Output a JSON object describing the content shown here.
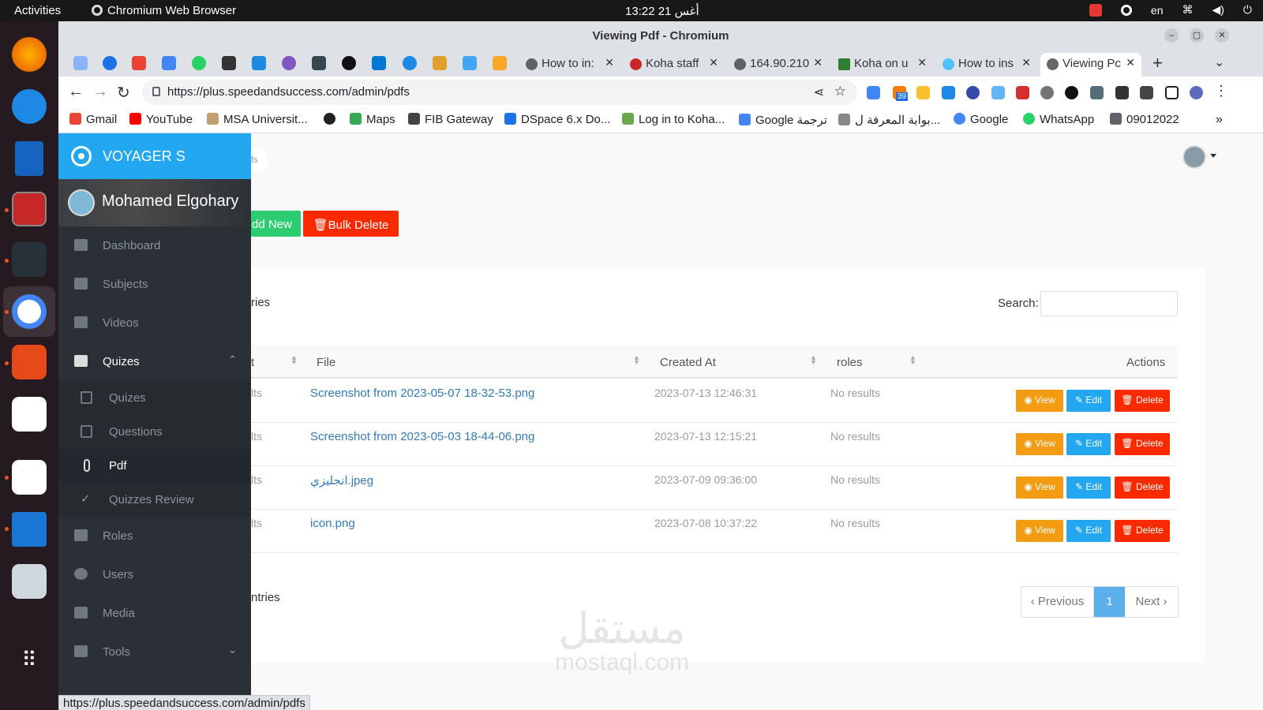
{
  "os": {
    "activities": "Activities",
    "app_name": "Chromium Web Browser",
    "clock": "13:22  21 أغس",
    "lang": "en"
  },
  "window_title": "Viewing Pdf - Chromium",
  "tabs": [
    {
      "label": "How to in:"
    },
    {
      "label": "Koha staff"
    },
    {
      "label": "164.90.210"
    },
    {
      "label": "Koha on u"
    },
    {
      "label": "How to ins"
    },
    {
      "label": "Viewing Pc"
    }
  ],
  "address": "https://plus.speedandsuccess.com/admin/pdfs",
  "ext_badge": "39",
  "bookmarks": [
    {
      "label": "Gmail",
      "color": "#ea4335"
    },
    {
      "label": "YouTube",
      "color": "#ff0000"
    },
    {
      "label": "MSA Universit...",
      "color": "#c0a070"
    },
    {
      "label": "",
      "color": "#222222"
    },
    {
      "label": "Maps",
      "color": "#34a853"
    },
    {
      "label": "FIB Gateway",
      "color": "#444444"
    },
    {
      "label": "DSpace 6.x Do...",
      "color": "#1a73e8"
    },
    {
      "label": "Log in to Koha...",
      "color": "#6aa84f"
    },
    {
      "label": "Google ترجمة",
      "color": "#4285f4"
    },
    {
      "label": "بوابة المعرفة ل...",
      "color": "#888888"
    },
    {
      "label": "Google",
      "color": "#4285f4"
    },
    {
      "label": "WhatsApp",
      "color": "#25d366"
    },
    {
      "label": "09012022",
      "color": "#5f6368"
    }
  ],
  "sidebar": {
    "brand": "VOYAGER S",
    "user": "Mohamed Elgohary",
    "items": [
      "Dashboard",
      "Subjects",
      "Videos",
      "Quizes",
      "Roles",
      "Users",
      "Media",
      "Tools"
    ],
    "subitems": [
      "Quizes",
      "Questions",
      "Pdf",
      "Quizzes Review"
    ]
  },
  "crumb": "fs",
  "buttons": {
    "add_new": "dd New",
    "bulk_delete": "Bulk Delete"
  },
  "entries_label": "ries",
  "entries_footer": "ntries",
  "search_label": "Search:",
  "search_value": "",
  "columns": [
    "t",
    "File",
    "Created At",
    "roles",
    "Actions"
  ],
  "rows": [
    {
      "c0": "lts",
      "file": "Screenshot from 2023-05-07 18-32-53.png",
      "created": "2023-07-13 12:46:31",
      "roles": "No results"
    },
    {
      "c0": "lts",
      "file": "Screenshot from 2023-05-03 18-44-06.png",
      "created": "2023-07-13 12:15:21",
      "roles": "No results"
    },
    {
      "c0": "lts",
      "file": "انجليزي.jpeg",
      "created": "2023-07-09 09:36:00",
      "roles": "No results"
    },
    {
      "c0": "lts",
      "file": "icon.png",
      "created": "2023-07-08 10:37:22",
      "roles": "No results"
    }
  ],
  "row_actions": {
    "view": "View",
    "edit": "Edit",
    "delete": "Delete"
  },
  "pager": {
    "prev": "Previous",
    "page": "1",
    "next": "Next"
  },
  "watermark": {
    "arabic": "مستقل",
    "latin": "mostaql.com"
  },
  "status_url": "https://plus.speedandsuccess.com/admin/pdfs",
  "colors": {
    "brand": "#22a7f0",
    "add": "#2ecc71",
    "delete": "#fa2a00",
    "view": "#f39c12",
    "edit": "#22a7f0",
    "sidebar": "#2a3035"
  }
}
